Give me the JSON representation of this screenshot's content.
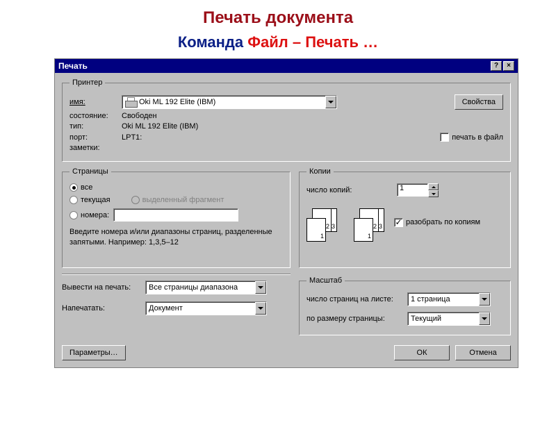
{
  "headings": {
    "h1": "Печать документа",
    "h2_prefix": "Команда ",
    "h2_red": "Файл – Печать …"
  },
  "titlebar": {
    "title": "Печать",
    "help": "?",
    "close": "×"
  },
  "printer": {
    "legend": "Принтер",
    "name_label": "имя:",
    "name_value": "Oki ML 192 Elite (IBM)",
    "properties_btn": "Свойства",
    "status_label": "состояние:",
    "status_value": "Свободен",
    "type_label": "тип:",
    "type_value": "Oki ML 192 Elite (IBM)",
    "port_label": "порт:",
    "port_value": "LPT1:",
    "notes_label": "заметки:",
    "to_file": "печать в файл"
  },
  "pages": {
    "legend": "Страницы",
    "all": "все",
    "current": "текущая",
    "selection": "выделенный фрагмент",
    "numbers": "номера:",
    "hint": "Введите номера и/или диапазоны страниц, разделенные запятыми. Например: 1,3,5–12"
  },
  "copies": {
    "legend": "Копии",
    "count_label": "число копий:",
    "count_value": "1",
    "collate": "разобрать по копиям",
    "p1": "1",
    "p2": "2",
    "p3": "3"
  },
  "scale": {
    "legend": "Масштаб",
    "pages_per_sheet_label": "число страниц на листе:",
    "pages_per_sheet_value": "1 страница",
    "fit_label": "по размеру страницы:",
    "fit_value": "Текущий"
  },
  "output": {
    "print_what_label": "Вывести на печать:",
    "print_what_value": "Все страницы диапазона",
    "print_label": "Напечатать:",
    "print_value": "Документ"
  },
  "buttons": {
    "params": "Параметры…",
    "ok": "ОК",
    "cancel": "Отмена"
  }
}
